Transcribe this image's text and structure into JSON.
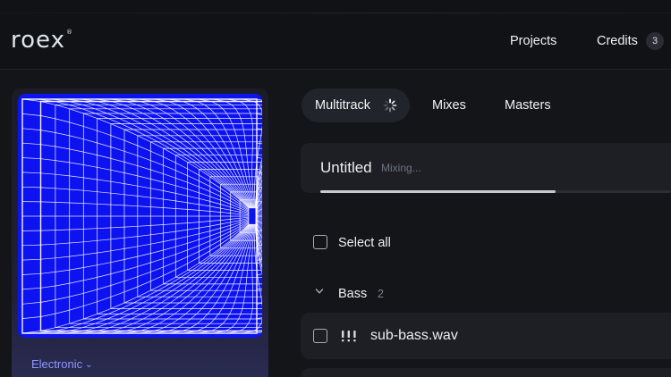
{
  "header": {
    "logo_text": "roex",
    "logo_mark": "®",
    "nav": {
      "projects": "Projects",
      "credits": "Credits"
    },
    "credits_count": "3"
  },
  "artwork": {
    "icon": "wireframe-tunnel-artwork",
    "background_color": "#0d12f0",
    "line_color": "#ffffff"
  },
  "genre": {
    "label": "Electronic",
    "icon": "chevron-down-icon"
  },
  "tabs": {
    "multitrack": "Multitrack",
    "mixes": "Mixes",
    "masters": "Masters",
    "active": "multitrack",
    "multitrack_icon": "loading-spinner-icon"
  },
  "project": {
    "title": "Untitled",
    "status": "Mixing...",
    "progress": 0.67
  },
  "select_all": {
    "label": "Select all",
    "checked": false
  },
  "groups": [
    {
      "name": "Bass",
      "count": "2",
      "expanded": true,
      "tracks": [
        {
          "name": "sub-bass.wav",
          "checked": false,
          "icon": "drag-handle-icon"
        }
      ]
    }
  ],
  "colors": {
    "background": "#141519",
    "card": "#1d1f25",
    "accent": "#8f95ff",
    "artwork_blue": "#0d12f0"
  }
}
